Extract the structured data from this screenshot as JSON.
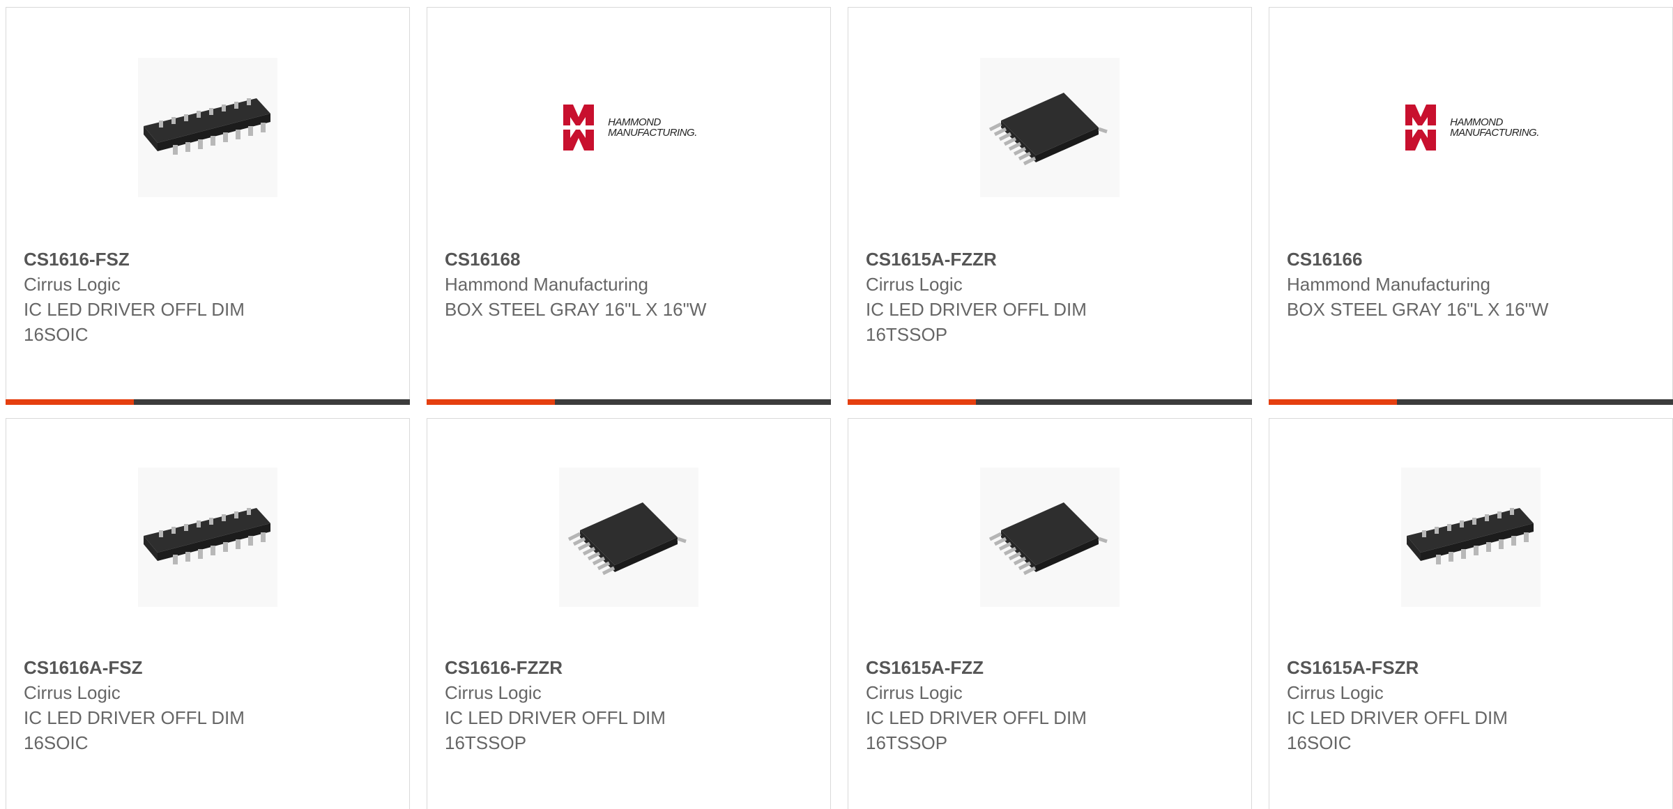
{
  "products": [
    {
      "part": "CS1616-FSZ",
      "manufacturer": "Cirrus Logic",
      "desc1": "IC LED DRIVER OFFL DIM",
      "desc2": "16SOIC",
      "image": "soic-chip-icon"
    },
    {
      "part": "CS16168",
      "manufacturer": "Hammond Manufacturing",
      "desc1": "BOX STEEL GRAY 16\"L X 16\"W",
      "desc2": "",
      "image": "hammond-logo",
      "logo_line1": "HAMMOND",
      "logo_line2": "MANUFACTURING."
    },
    {
      "part": "CS1615A-FZZR",
      "manufacturer": "Cirrus Logic",
      "desc1": "IC LED DRIVER OFFL DIM",
      "desc2": "16TSSOP",
      "image": "tssop-chip-icon"
    },
    {
      "part": "CS16166",
      "manufacturer": "Hammond Manufacturing",
      "desc1": "BOX STEEL GRAY 16\"L X 16\"W",
      "desc2": "",
      "image": "hammond-logo",
      "logo_line1": "HAMMOND",
      "logo_line2": "MANUFACTURING."
    },
    {
      "part": "CS1616A-FSZ",
      "manufacturer": "Cirrus Logic",
      "desc1": "IC LED DRIVER OFFL DIM",
      "desc2": "16SOIC",
      "image": "soic-chip-icon"
    },
    {
      "part": "CS1616-FZZR",
      "manufacturer": "Cirrus Logic",
      "desc1": "IC LED DRIVER OFFL DIM",
      "desc2": "16TSSOP",
      "image": "tssop-chip-icon"
    },
    {
      "part": "CS1615A-FZZ",
      "manufacturer": "Cirrus Logic",
      "desc1": "IC LED DRIVER OFFL DIM",
      "desc2": "16TSSOP",
      "image": "tssop-chip-icon"
    },
    {
      "part": "CS1615A-FSZR",
      "manufacturer": "Cirrus Logic",
      "desc1": "IC LED DRIVER OFFL DIM",
      "desc2": "16SOIC",
      "image": "soic-chip-icon"
    }
  ],
  "colors": {
    "accent": "#e53f0f",
    "bar": "#3c3c3c",
    "border": "#d9d9d9",
    "text": "#666666",
    "logo_red": "#c8102e"
  }
}
